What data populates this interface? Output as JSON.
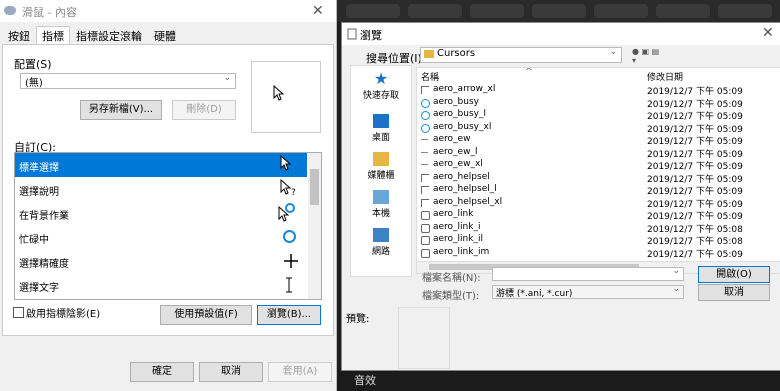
{
  "mouse_dialog": {
    "title": "滑鼠 - 內容",
    "tabs": [
      "按鈕",
      "指標",
      "指標設定",
      "滾輪",
      "硬體"
    ],
    "scheme_label": "配置(S)",
    "scheme_value": "(無)",
    "save_as_label": "另存新檔(V)...",
    "delete_label": "刪除(D)",
    "customize_label": "自訂(C):",
    "pointers": [
      {
        "name": "標準選擇",
        "icon": "arrow-cursor-icon"
      },
      {
        "name": "選擇說明",
        "icon": "help-cursor-icon"
      },
      {
        "name": "在背景作業",
        "icon": "working-in-background-icon"
      },
      {
        "name": "忙碌中",
        "icon": "busy-ring-icon"
      },
      {
        "name": "選擇精確度",
        "icon": "crosshair-icon"
      },
      {
        "name": "選擇文字",
        "icon": "ibeam-icon"
      }
    ],
    "shadow_label": "啟用指標陰影(E)",
    "use_default_label": "使用預設值(F)",
    "browse_label": "瀏覽(B)...",
    "ok_label": "確定",
    "cancel_label": "取消",
    "apply_label": "套用(A)"
  },
  "browse_dialog": {
    "title": "瀏覽",
    "look_in_label": "搜尋位置(I):",
    "look_in_value": "Cursors",
    "sidebar": [
      "快速存取",
      "桌面",
      "媒體櫃",
      "本機",
      "網路"
    ],
    "col_name": "名稱",
    "col_date": "修改日期",
    "files": [
      {
        "name": "aero_arrow_xl",
        "date": "2019/12/7 下午 05:09",
        "icon": "arrow-cursor-icon"
      },
      {
        "name": "aero_busy",
        "date": "2019/12/7 下午 05:09",
        "icon": "busy-ring-icon"
      },
      {
        "name": "aero_busy_l",
        "date": "2019/12/7 下午 05:09",
        "icon": "busy-ring-icon"
      },
      {
        "name": "aero_busy_xl",
        "date": "2019/12/7 下午 05:09",
        "icon": "busy-ring-icon"
      },
      {
        "name": "aero_ew",
        "date": "2019/12/7 下午 05:09",
        "icon": "resize-ew-icon"
      },
      {
        "name": "aero_ew_l",
        "date": "2019/12/7 下午 05:09",
        "icon": "resize-ew-icon"
      },
      {
        "name": "aero_ew_xl",
        "date": "2019/12/7 下午 05:09",
        "icon": "resize-ew-icon"
      },
      {
        "name": "aero_helpsel",
        "date": "2019/12/7 下午 05:09",
        "icon": "help-cursor-icon"
      },
      {
        "name": "aero_helpsel_l",
        "date": "2019/12/7 下午 05:09",
        "icon": "help-cursor-icon"
      },
      {
        "name": "aero_helpsel_xl",
        "date": "2019/12/7 下午 05:09",
        "icon": "help-cursor-icon"
      },
      {
        "name": "aero_link",
        "date": "2019/12/7 下午 05:09",
        "icon": "hand-cursor-icon"
      },
      {
        "name": "aero_link_i",
        "date": "2019/12/7 下午 05:08",
        "icon": "hand-cursor-icon"
      },
      {
        "name": "aero_link_il",
        "date": "2019/12/7 下午 05:08",
        "icon": "hand-cursor-icon"
      },
      {
        "name": "aero_link_im",
        "date": "2019/12/7 下午 05:09",
        "icon": "hand-cursor-icon"
      }
    ],
    "filename_label": "檔案名稱(N):",
    "filename_value": "",
    "filetype_label": "檔案類型(T):",
    "filetype_value": "游標 (*.ani, *.cur)",
    "open_label": "開啟(O)",
    "cancel_label": "取消",
    "preview_label": "預覽:"
  },
  "background": {
    "bottom_text": "音效"
  }
}
